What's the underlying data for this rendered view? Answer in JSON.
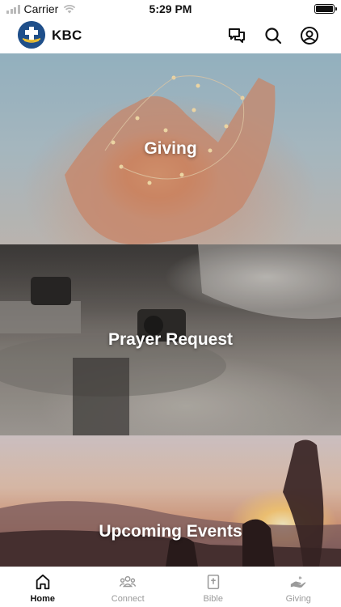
{
  "status_bar": {
    "carrier": "Carrier",
    "time": "5:29 PM"
  },
  "header": {
    "app_name": "KBC",
    "icons": [
      "logo-icon",
      "chat-icon",
      "search-icon",
      "profile-icon"
    ]
  },
  "tiles": [
    {
      "label": "Giving"
    },
    {
      "label": "Prayer Request"
    },
    {
      "label": "Upcoming Events"
    }
  ],
  "tabs": [
    {
      "label": "Home",
      "icon": "home-icon",
      "active": true
    },
    {
      "label": "Connect",
      "icon": "people-icon",
      "active": false
    },
    {
      "label": "Bible",
      "icon": "bible-icon",
      "active": false
    },
    {
      "label": "Giving",
      "icon": "giving-hand-icon",
      "active": false
    }
  ],
  "colors": {
    "accent": "#111111",
    "inactive": "#9a9a9a",
    "logo_bg": "#1f4f8a"
  }
}
